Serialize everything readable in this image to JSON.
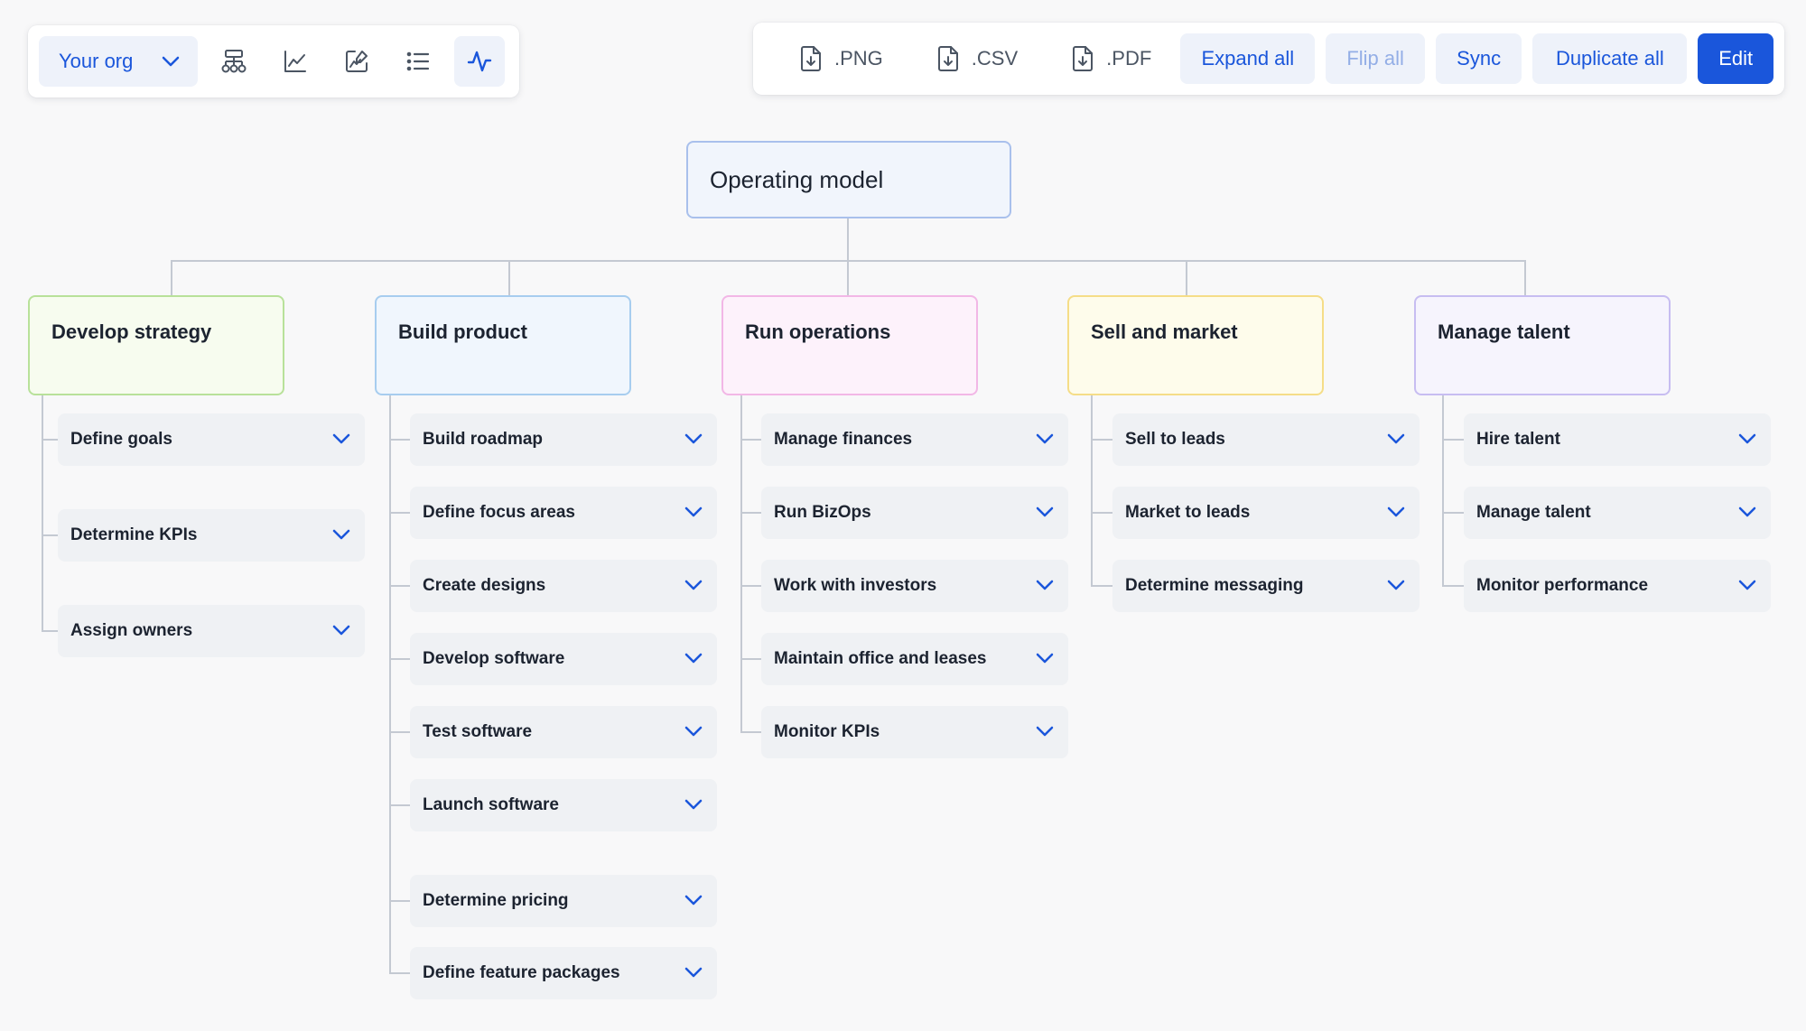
{
  "toolbar": {
    "org_label": "Your org",
    "tools": [
      {
        "name": "org-chart-icon"
      },
      {
        "name": "line-chart-icon"
      },
      {
        "name": "edit-chart-icon"
      },
      {
        "name": "list-icon"
      },
      {
        "name": "activity-icon",
        "active": true
      }
    ],
    "exports": [
      ".PNG",
      ".CSV",
      ".PDF"
    ],
    "expand_all": "Expand all",
    "flip_all": "Flip all",
    "sync": "Sync",
    "duplicate_all": "Duplicate all",
    "edit": "Edit"
  },
  "colors": {
    "accent": "#1a56db",
    "accent_soft": "#eef2fa",
    "disabled": "#93aee6",
    "connector": "#c4c9d2"
  },
  "tree": {
    "root": "Operating model",
    "categories": [
      {
        "label": "Develop strategy",
        "tasks": [
          "Define goals",
          "Determine KPIs",
          "Assign owners"
        ]
      },
      {
        "label": "Build product",
        "tasks": [
          "Build roadmap",
          "Define focus areas",
          "Create designs",
          "Develop software",
          "Test software",
          "Launch software",
          "Determine pricing",
          "Define feature packages"
        ]
      },
      {
        "label": "Run operations",
        "tasks": [
          "Manage finances",
          "Run BizOps",
          "Work with investors",
          "Maintain office and leases",
          "Monitor KPIs"
        ]
      },
      {
        "label": "Sell and market",
        "tasks": [
          "Sell to leads",
          "Market to leads",
          "Determine messaging"
        ]
      },
      {
        "label": "Manage talent",
        "tasks": [
          "Hire talent",
          "Manage talent",
          "Monitor performance"
        ]
      }
    ]
  }
}
